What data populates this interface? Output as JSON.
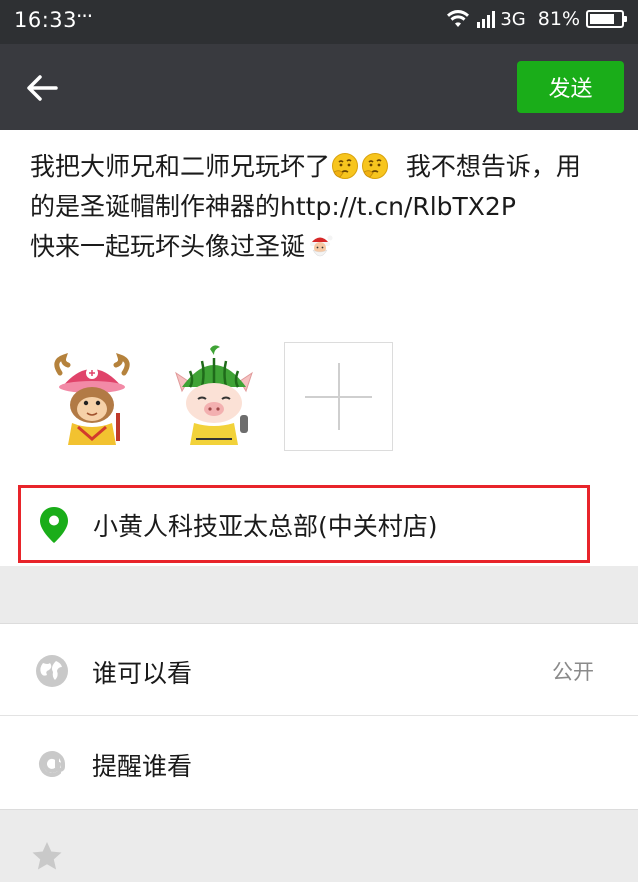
{
  "status_bar": {
    "time": "16:33",
    "dots": "···",
    "network": "3G",
    "battery": "81%",
    "battery_level_percent": 81
  },
  "nav": {
    "back_icon": "arrow-left-icon",
    "send_label": "发送",
    "send_color": "#1aad19"
  },
  "post": {
    "text_part1": "我把大师兄和二师兄玩坏了",
    "text_part2": "  我不想告诉，用的是圣诞帽制作神器的http://t.cn/RlbTX2P        快来一起玩坏头像过圣诞",
    "emojis": [
      "thinking-face-icon",
      "thinking-face-icon",
      "santa-emoji-icon"
    ]
  },
  "photos": {
    "items": [
      "monkey-with-reindeer-hat-photo",
      "pig-with-watermelon-hat-photo"
    ],
    "add_icon": "plus-icon"
  },
  "location": {
    "icon": "location-pin-icon",
    "label": "小黄人科技亚太总部(中关村店)",
    "pin_color": "#1aad19",
    "highlight_color": "#e8242a"
  },
  "options": {
    "visibility_label": "谁可以看",
    "visibility_value": "公开",
    "mention_label": "提醒谁看"
  }
}
